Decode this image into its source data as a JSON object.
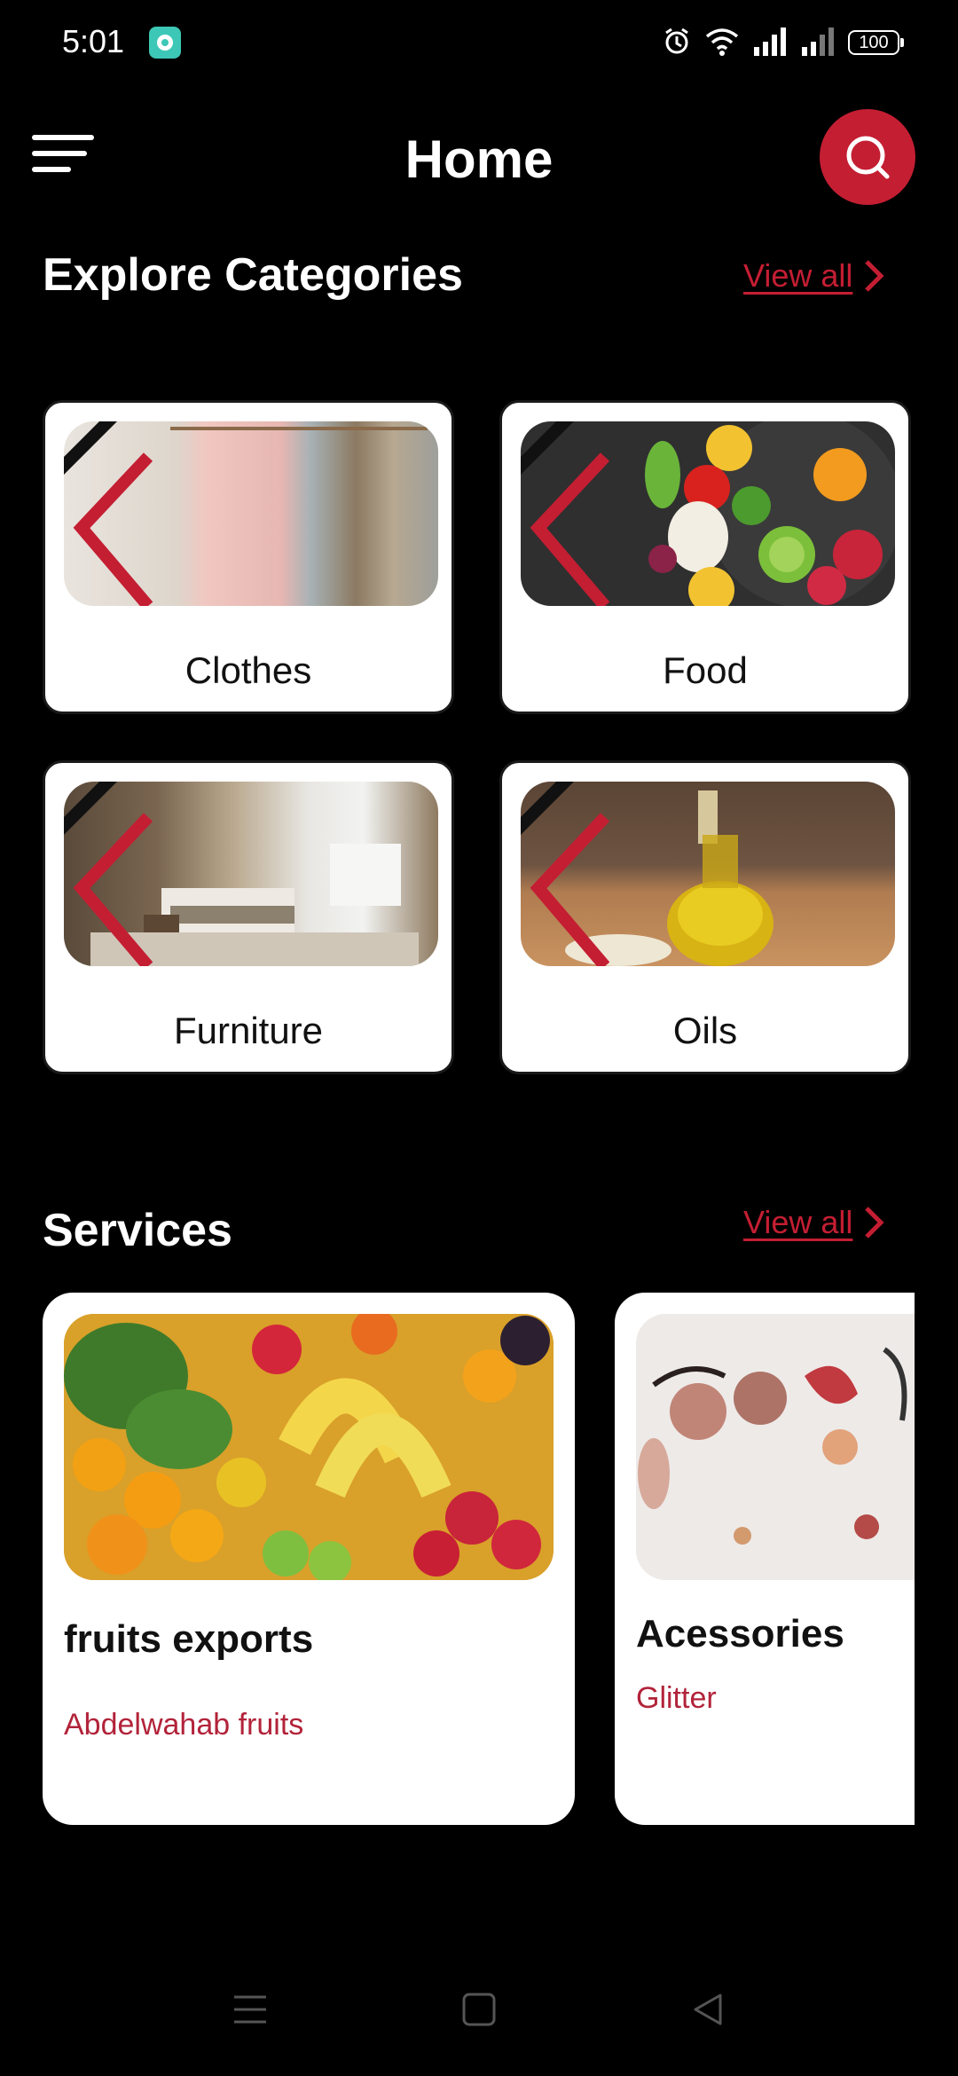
{
  "status_bar": {
    "time": "5:01",
    "battery": "100",
    "icons": [
      "chat-app-icon",
      "alarm-icon",
      "wifi-icon",
      "signal-icon",
      "signal-icon-2",
      "battery-icon"
    ]
  },
  "header": {
    "title": "Home",
    "menu_icon": "hamburger-menu-icon",
    "search_icon": "search-icon"
  },
  "colors": {
    "accent": "#c41e33",
    "background": "#000000",
    "card": "#ffffff",
    "subtitle_red": "#b2233a"
  },
  "categories_section": {
    "title": "Explore Categories",
    "view_all": "View all",
    "items": [
      {
        "label": "Clothes"
      },
      {
        "label": "Food"
      },
      {
        "label": "Furniture"
      },
      {
        "label": "Oils"
      }
    ]
  },
  "services_section": {
    "title": "Services",
    "view_all": "View all",
    "items": [
      {
        "title": "fruits exports",
        "subtitle": "Abdelwahab fruits"
      },
      {
        "title": "Acessories",
        "subtitle": "Glitter"
      }
    ]
  },
  "bottom_nav": {
    "icons": [
      "recent-apps-icon",
      "home-icon",
      "back-icon"
    ]
  }
}
